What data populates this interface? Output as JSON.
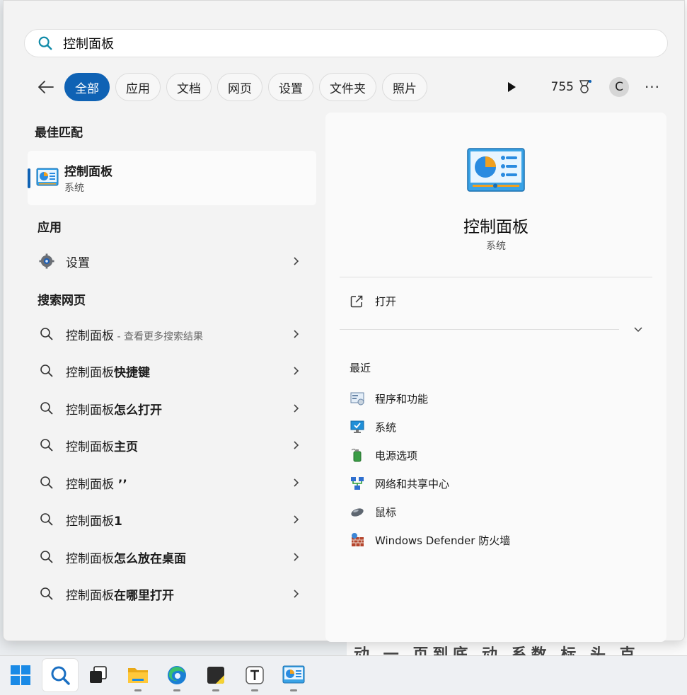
{
  "search": {
    "value": "控制面板"
  },
  "filters": {
    "chips": [
      "全部",
      "应用",
      "文档",
      "网页",
      "设置",
      "文件夹",
      "照片"
    ],
    "points": "755",
    "avatar_letter": "C",
    "more": "···"
  },
  "best_match": {
    "section_label": "最佳匹配",
    "title": "控制面板",
    "subtitle": "系统"
  },
  "apps": {
    "section_label": "应用",
    "items": [
      {
        "label": "设置"
      }
    ]
  },
  "web": {
    "section_label": "搜索网页",
    "items": [
      {
        "prefix": "控制面板",
        "bold": "",
        "hint": " - 查看更多搜索结果"
      },
      {
        "prefix": "控制面板",
        "bold": "快捷键",
        "hint": ""
      },
      {
        "prefix": "控制面板",
        "bold": "怎么打开",
        "hint": ""
      },
      {
        "prefix": "控制面板",
        "bold": "主页",
        "hint": ""
      },
      {
        "prefix": "控制面板",
        "bold": " ’’",
        "hint": ""
      },
      {
        "prefix": "控制面板",
        "bold": "1",
        "hint": ""
      },
      {
        "prefix": "控制面板",
        "bold": "怎么放在桌面",
        "hint": ""
      },
      {
        "prefix": "控制面板",
        "bold": "在哪里打开",
        "hint": ""
      }
    ]
  },
  "preview": {
    "title": "控制面板",
    "subtitle": "系统",
    "open_label": "打开",
    "recent_label": "最近",
    "recent_items": [
      {
        "label": "程序和功能",
        "icon": "programs-features-icon"
      },
      {
        "label": "系统",
        "icon": "system-icon"
      },
      {
        "label": "电源选项",
        "icon": "power-options-icon"
      },
      {
        "label": "网络和共享中心",
        "icon": "network-sharing-icon"
      },
      {
        "label": "鼠标",
        "icon": "mouse-icon"
      },
      {
        "label": "Windows Defender 防火墙",
        "icon": "firewall-icon"
      }
    ]
  },
  "background": {
    "strip_text": "动 一 页到底 动 系数 标 头 克"
  },
  "taskbar": {
    "items": [
      "windows-start-icon",
      "search-icon",
      "task-view-icon",
      "file-explorer-icon",
      "edge-icon",
      "sticky-notes-icon",
      "typora-icon",
      "control-panel-icon"
    ]
  },
  "colors": {
    "accent": "#0f62b4",
    "panel": "#f3f3f3"
  }
}
